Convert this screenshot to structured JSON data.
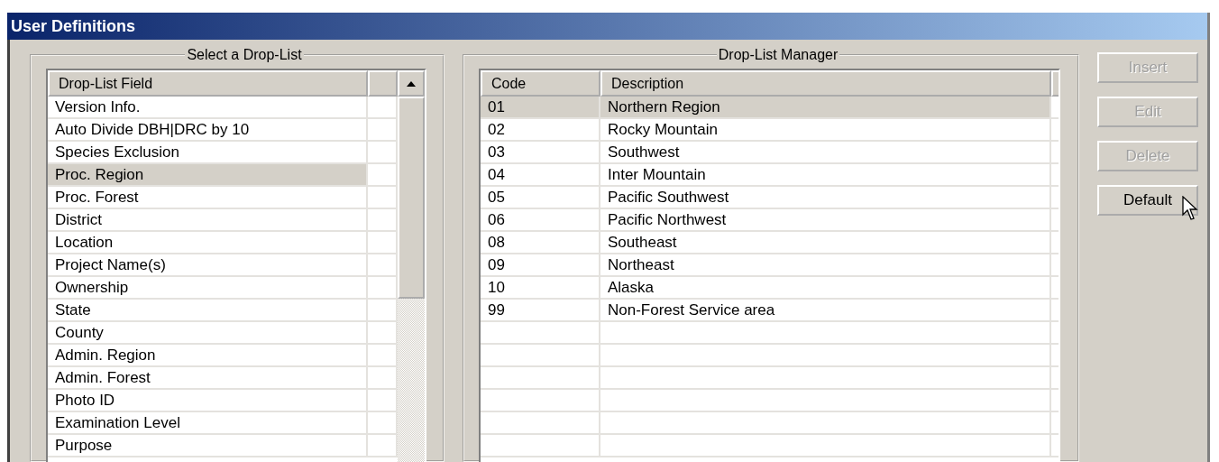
{
  "window": {
    "title": "User Definitions"
  },
  "select_group": {
    "title": "Select a Drop-List",
    "column": "Drop-List Field",
    "rows": [
      {
        "label": "Version Info.",
        "selected": false
      },
      {
        "label": "Auto Divide DBH|DRC by 10",
        "selected": false
      },
      {
        "label": "Species Exclusion",
        "selected": false
      },
      {
        "label": "Proc. Region",
        "selected": true
      },
      {
        "label": "Proc. Forest",
        "selected": false
      },
      {
        "label": "District",
        "selected": false
      },
      {
        "label": "Location",
        "selected": false
      },
      {
        "label": "Project Name(s)",
        "selected": false
      },
      {
        "label": "Ownership",
        "selected": false
      },
      {
        "label": "State",
        "selected": false
      },
      {
        "label": "County",
        "selected": false
      },
      {
        "label": "Admin. Region",
        "selected": false
      },
      {
        "label": "Admin. Forest",
        "selected": false
      },
      {
        "label": "Photo ID",
        "selected": false
      },
      {
        "label": "Examination Level",
        "selected": false
      },
      {
        "label": "Purpose",
        "selected": false
      }
    ]
  },
  "manager_group": {
    "title": "Drop-List Manager",
    "columns": [
      "Code",
      "Description"
    ],
    "rows": [
      {
        "code": "01",
        "description": "Northern Region",
        "selected": true
      },
      {
        "code": "02",
        "description": "Rocky Mountain",
        "selected": false
      },
      {
        "code": "03",
        "description": "Southwest",
        "selected": false
      },
      {
        "code": "04",
        "description": "Inter Mountain",
        "selected": false
      },
      {
        "code": "05",
        "description": "Pacific Southwest",
        "selected": false
      },
      {
        "code": "06",
        "description": "Pacific Northwest",
        "selected": false
      },
      {
        "code": "08",
        "description": "Southeast",
        "selected": false
      },
      {
        "code": "09",
        "description": "Northeast",
        "selected": false
      },
      {
        "code": "10",
        "description": "Alaska",
        "selected": false
      },
      {
        "code": "99",
        "description": "Non-Forest Service area",
        "selected": false
      }
    ]
  },
  "buttons": [
    {
      "label": "Insert",
      "disabled": true
    },
    {
      "label": "Edit",
      "disabled": true
    },
    {
      "label": "Delete",
      "disabled": true
    },
    {
      "label": "Default",
      "disabled": false
    }
  ]
}
